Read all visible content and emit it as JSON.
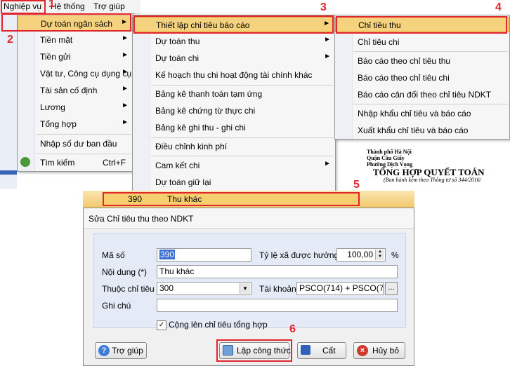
{
  "menubar": {
    "items": [
      "Nghiệp vụ",
      "Hệ thống",
      "Trợ giúp"
    ]
  },
  "menu1": {
    "items": [
      {
        "label": "Dự toán ngân sách",
        "arrow": "►"
      },
      {
        "label": "Tiền mặt",
        "arrow": "►"
      },
      {
        "label": "Tiền gửi",
        "arrow": "►"
      },
      {
        "label": "Vật tư, Công cụ dụng cụ",
        "arrow": "►"
      },
      {
        "label": "Tài sản cố định",
        "arrow": "►"
      },
      {
        "label": "Lương",
        "arrow": "►"
      },
      {
        "label": "Tổng hợp",
        "arrow": "►"
      },
      {
        "label": "Nhập số dư ban đầu"
      },
      {
        "label": "Tìm kiếm",
        "shortcut": "Ctrl+F"
      }
    ]
  },
  "menu2": {
    "items": [
      {
        "label": "Thiết lập chỉ tiêu báo cáo",
        "arrow": "►"
      },
      {
        "label": "Dự toán thu",
        "arrow": "►"
      },
      {
        "label": "Dự toán chi",
        "arrow": "►"
      },
      {
        "label": "Kế hoạch thu chi hoạt động tài chính khác"
      },
      {
        "label": "Bảng kê thanh toán tạm ứng"
      },
      {
        "label": "Bảng kê chứng từ thực chi"
      },
      {
        "label": "Bảng kê ghi thu - ghi chi"
      },
      {
        "label": "Điều chỉnh kinh phí"
      },
      {
        "label": "Cam kết chi",
        "arrow": "►"
      },
      {
        "label": "Dự toán giữ lại"
      }
    ]
  },
  "menu3": {
    "items": [
      {
        "label": "Chỉ tiêu thu"
      },
      {
        "label": "Chỉ tiêu chi"
      },
      {
        "label": "Báo cáo theo chỉ tiêu thu"
      },
      {
        "label": "Báo cáo theo chỉ tiêu chi"
      },
      {
        "label": "Báo cáo cân đối theo chỉ tiêu NDKT"
      },
      {
        "label": "Nhập khẩu chỉ tiêu và báo cáo"
      },
      {
        "label": "Xuất khẩu chỉ tiêu và báo cáo"
      }
    ]
  },
  "steps": [
    "1",
    "2",
    "3",
    "4",
    "5",
    "6"
  ],
  "doc": {
    "line1": "Thành phố Hà Nội",
    "line2": "Quận Cầu Giấy",
    "line3": "Phường Dịch Vọng",
    "title": "TỔNG HỢP QUYẾT TOÁN",
    "subtitle": "(Ban hành kèm theo Thông tư số 344/2016/"
  },
  "grid_row": {
    "code": "390",
    "name": "Thu khác"
  },
  "dialog": {
    "title": "Sửa Chỉ tiêu thu theo NDKT",
    "ma_so_label": "Mã số",
    "ma_so_value": "390",
    "ty_le_label": "Tỷ lệ xã được hưởng",
    "ty_le_value": "100,00",
    "percent": "%",
    "noi_dung_label": "Nội dung (*)",
    "noi_dung_value": "Thu khác",
    "thuoc_label": "Thuộc chỉ tiêu",
    "thuoc_value": "300",
    "tai_khoan_label": "Tài khoản",
    "tai_khoan_value": "PSCO(714) + PSCO(7",
    "browse": "...",
    "ghi_chu_label": "Ghi chú",
    "ghi_chu_value": "",
    "checkbox_label": "Cộng lên chỉ tiêu tổng hợp",
    "checkbox_checked": true,
    "btn_help": "Trợ giúp",
    "btn_formula": "Lập công thức",
    "btn_save": "Cất",
    "btn_cancel": "Hủy bỏ"
  }
}
